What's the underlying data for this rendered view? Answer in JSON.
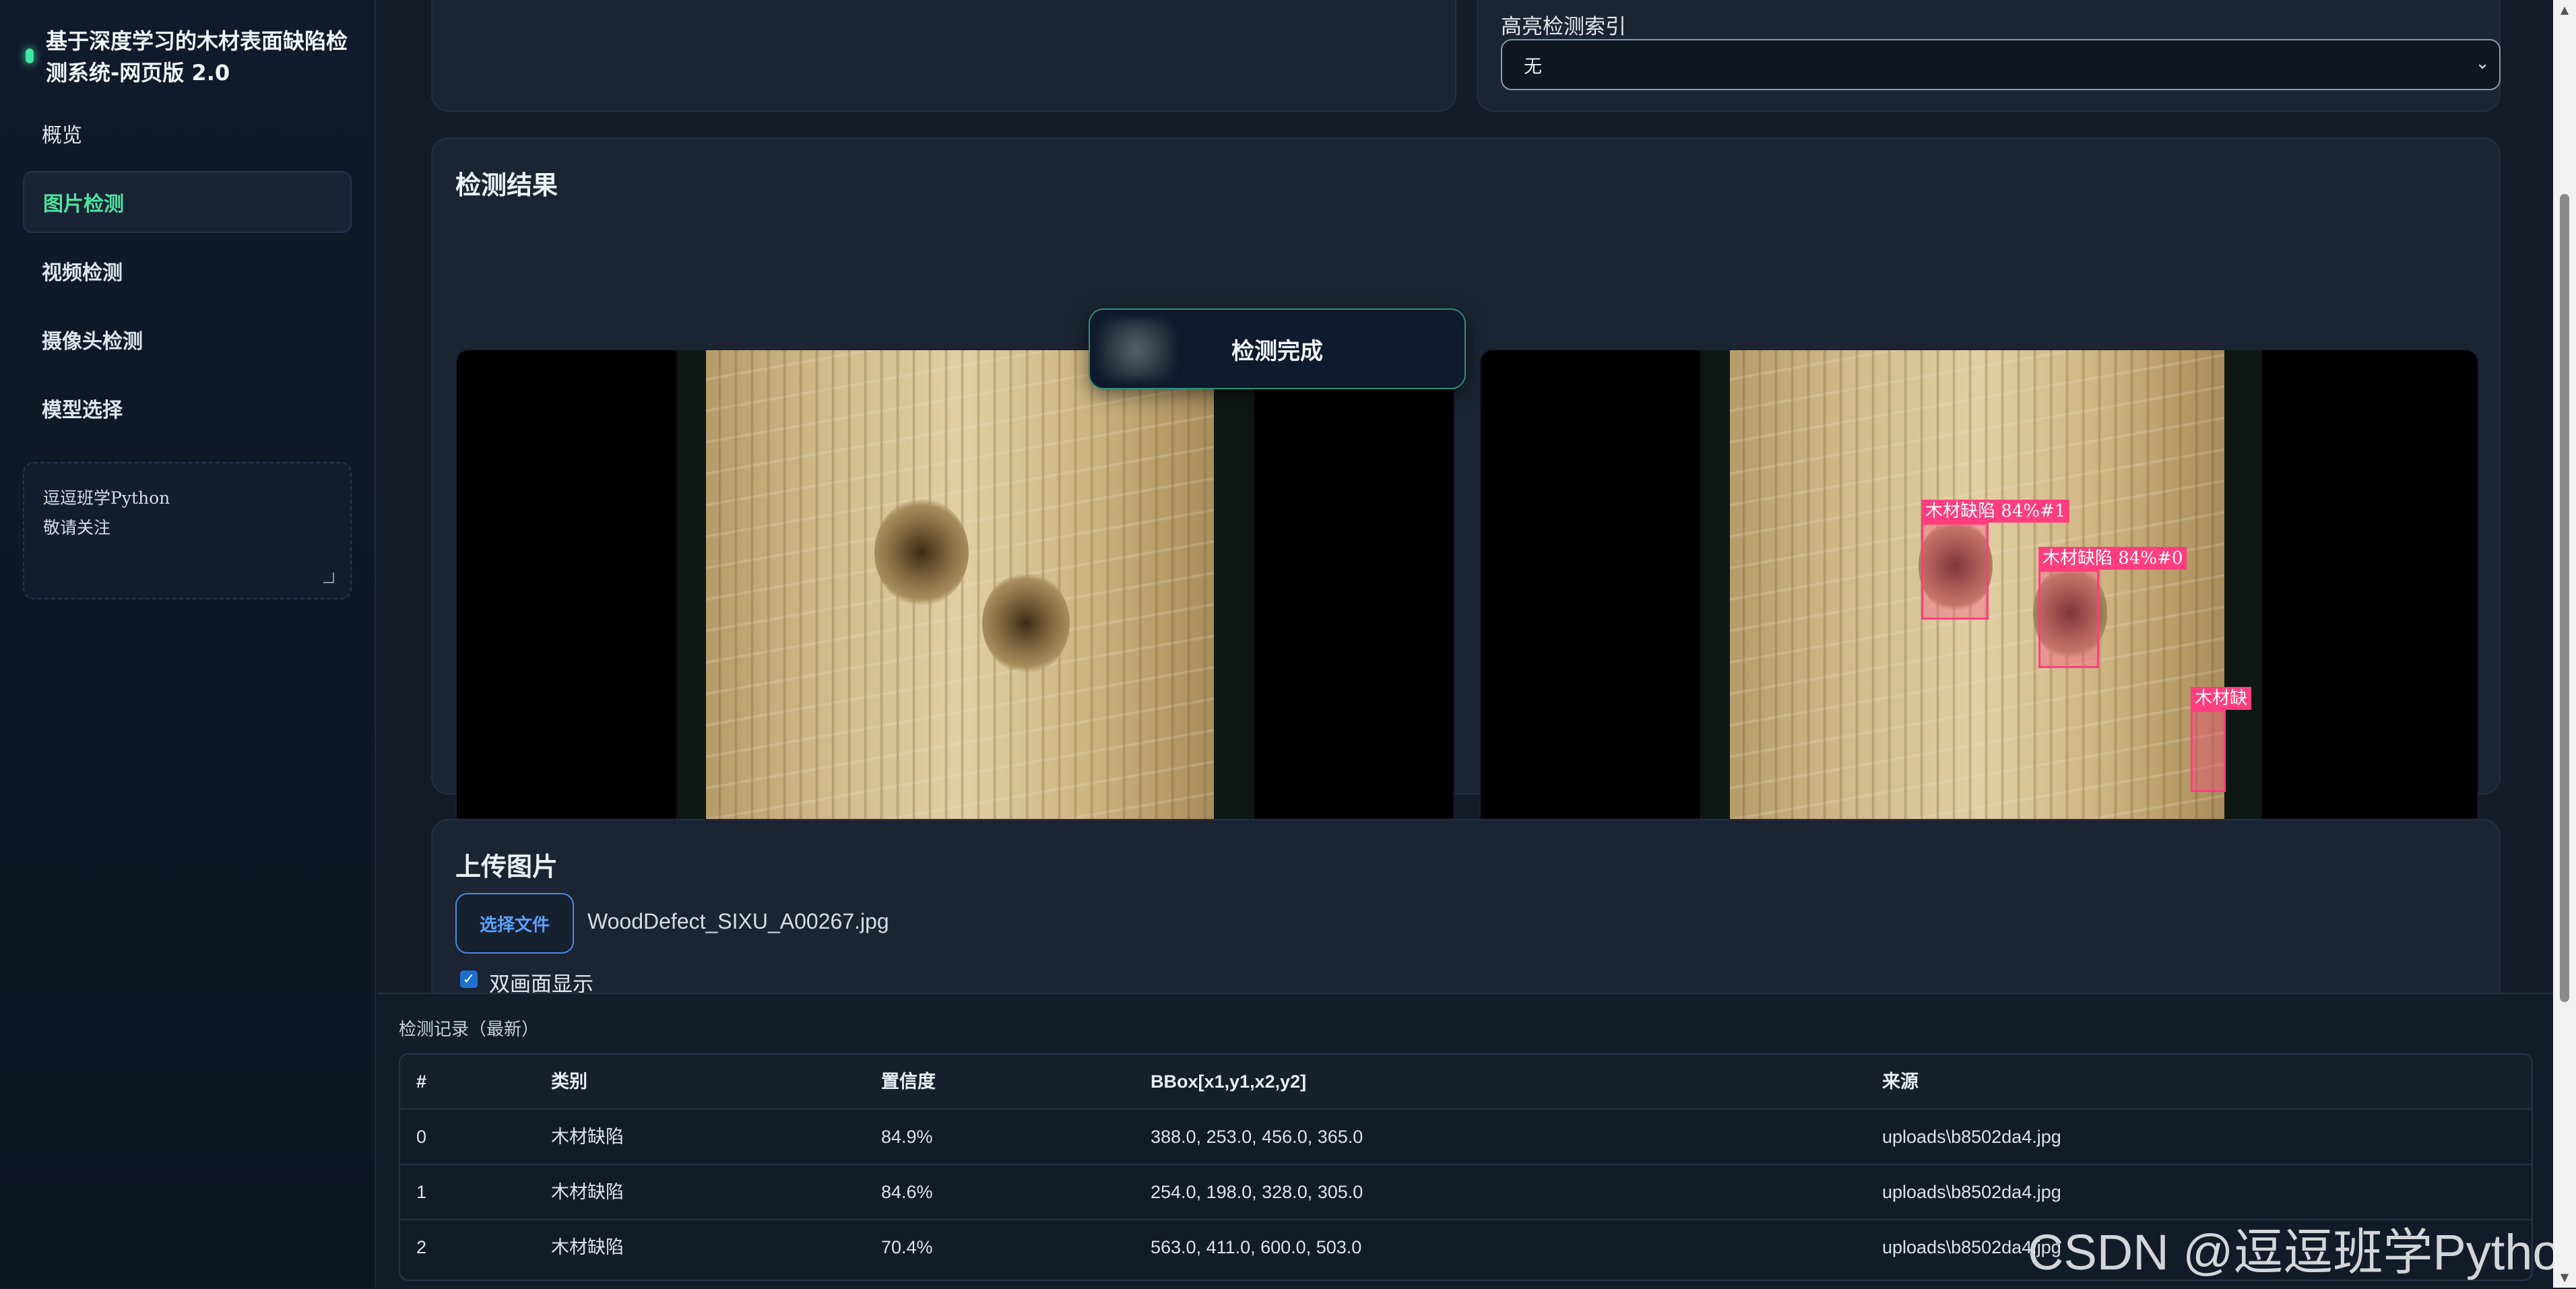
{
  "brand": {
    "title": "基于深度学习的木材表面缺陷检测系统-网页版 2.0"
  },
  "nav": {
    "overview": "概览",
    "image_detect": "图片检测",
    "video_detect": "视频检测",
    "camera_detect": "摄像头检测",
    "model_select": "模型选择"
  },
  "note": {
    "line1": "逗逗班学Python",
    "line2": "敬请关注"
  },
  "highlight": {
    "label": "高亮检测索引",
    "value": "无"
  },
  "result": {
    "title": "检测结果",
    "toast": "检测完成",
    "labels": [
      "木材缺陷 84%#1",
      "木材缺陷 84%#0",
      "木材缺"
    ]
  },
  "upload": {
    "title": "上传图片",
    "choose_label": "选择文件",
    "file_name": "WoodDefect_SIXU_A00267.jpg",
    "dual_view_label": "双画面显示",
    "dual_view_checked": true
  },
  "records": {
    "title": "检测记录（最新）",
    "columns": [
      "#",
      "类别",
      "置信度",
      "BBox[x1,y1,x2,y2]",
      "来源"
    ],
    "rows": [
      [
        "0",
        "木材缺陷",
        "84.9%",
        "388.0, 253.0, 456.0, 365.0",
        "uploads\\b8502da4.jpg"
      ],
      [
        "1",
        "木材缺陷",
        "84.6%",
        "254.0, 198.0, 328.0, 305.0",
        "uploads\\b8502da4.jpg"
      ],
      [
        "2",
        "木材缺陷",
        "70.4%",
        "563.0, 411.0, 600.0, 503.0",
        "uploads\\b8502da4.jpg"
      ]
    ]
  },
  "watermark": "CSDN @逗逗班学Python",
  "colors": {
    "accent": "#4ee3a0",
    "detection": "#ff3d7f",
    "link": "#5aa2ff"
  }
}
